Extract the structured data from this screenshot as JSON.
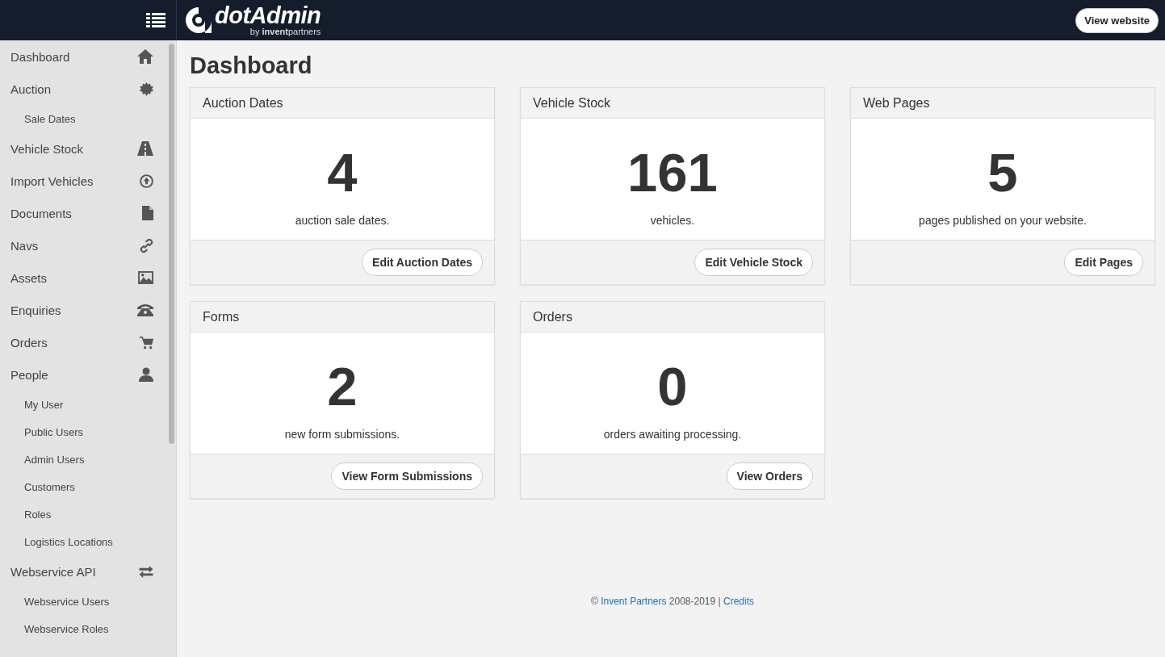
{
  "header": {
    "logo_name": "dotAdmin",
    "logo_tagline": "by **invent**partners",
    "view_button": "View website"
  },
  "sidebar": {
    "items": [
      {
        "label": "Dashboard"
      },
      {
        "label": "Auction",
        "children": [
          {
            "label": "Sale Dates"
          }
        ]
      },
      {
        "label": "Vehicle Stock"
      },
      {
        "label": "Import Vehicles"
      },
      {
        "label": "Documents"
      },
      {
        "label": "Navs"
      },
      {
        "label": "Assets"
      },
      {
        "label": "Enquiries"
      },
      {
        "label": "Orders"
      },
      {
        "label": "People",
        "children": [
          {
            "label": "My User"
          },
          {
            "label": "Public Users"
          },
          {
            "label": "Admin Users"
          },
          {
            "label": "Customers"
          },
          {
            "label": "Roles"
          },
          {
            "label": "Logistics Locations"
          }
        ]
      },
      {
        "label": "Webservice API",
        "children": [
          {
            "label": "Webservice Users"
          },
          {
            "label": "Webservice Roles"
          }
        ]
      }
    ]
  },
  "page_title": "Dashboard",
  "cards": [
    {
      "title": "Auction Dates",
      "count": "4",
      "caption": "auction sale dates.",
      "button": "Edit Auction Dates"
    },
    {
      "title": "Vehicle Stock",
      "count": "161",
      "caption": "vehicles.",
      "button": "Edit Vehicle Stock"
    },
    {
      "title": "Web Pages",
      "count": "5",
      "caption": "pages published on your website.",
      "button": "Edit Pages"
    },
    {
      "title": "Forms",
      "count": "2",
      "caption": "new form submissions.",
      "button": "View Form Submissions"
    },
    {
      "title": "Orders",
      "count": "0",
      "caption": "orders awaiting processing.",
      "button": "View Orders"
    }
  ],
  "footer": {
    "prefix": "©",
    "owner_link": "Invent Partners",
    "years": "2008-2019",
    "separator": "|",
    "credits_link": "Credits"
  }
}
